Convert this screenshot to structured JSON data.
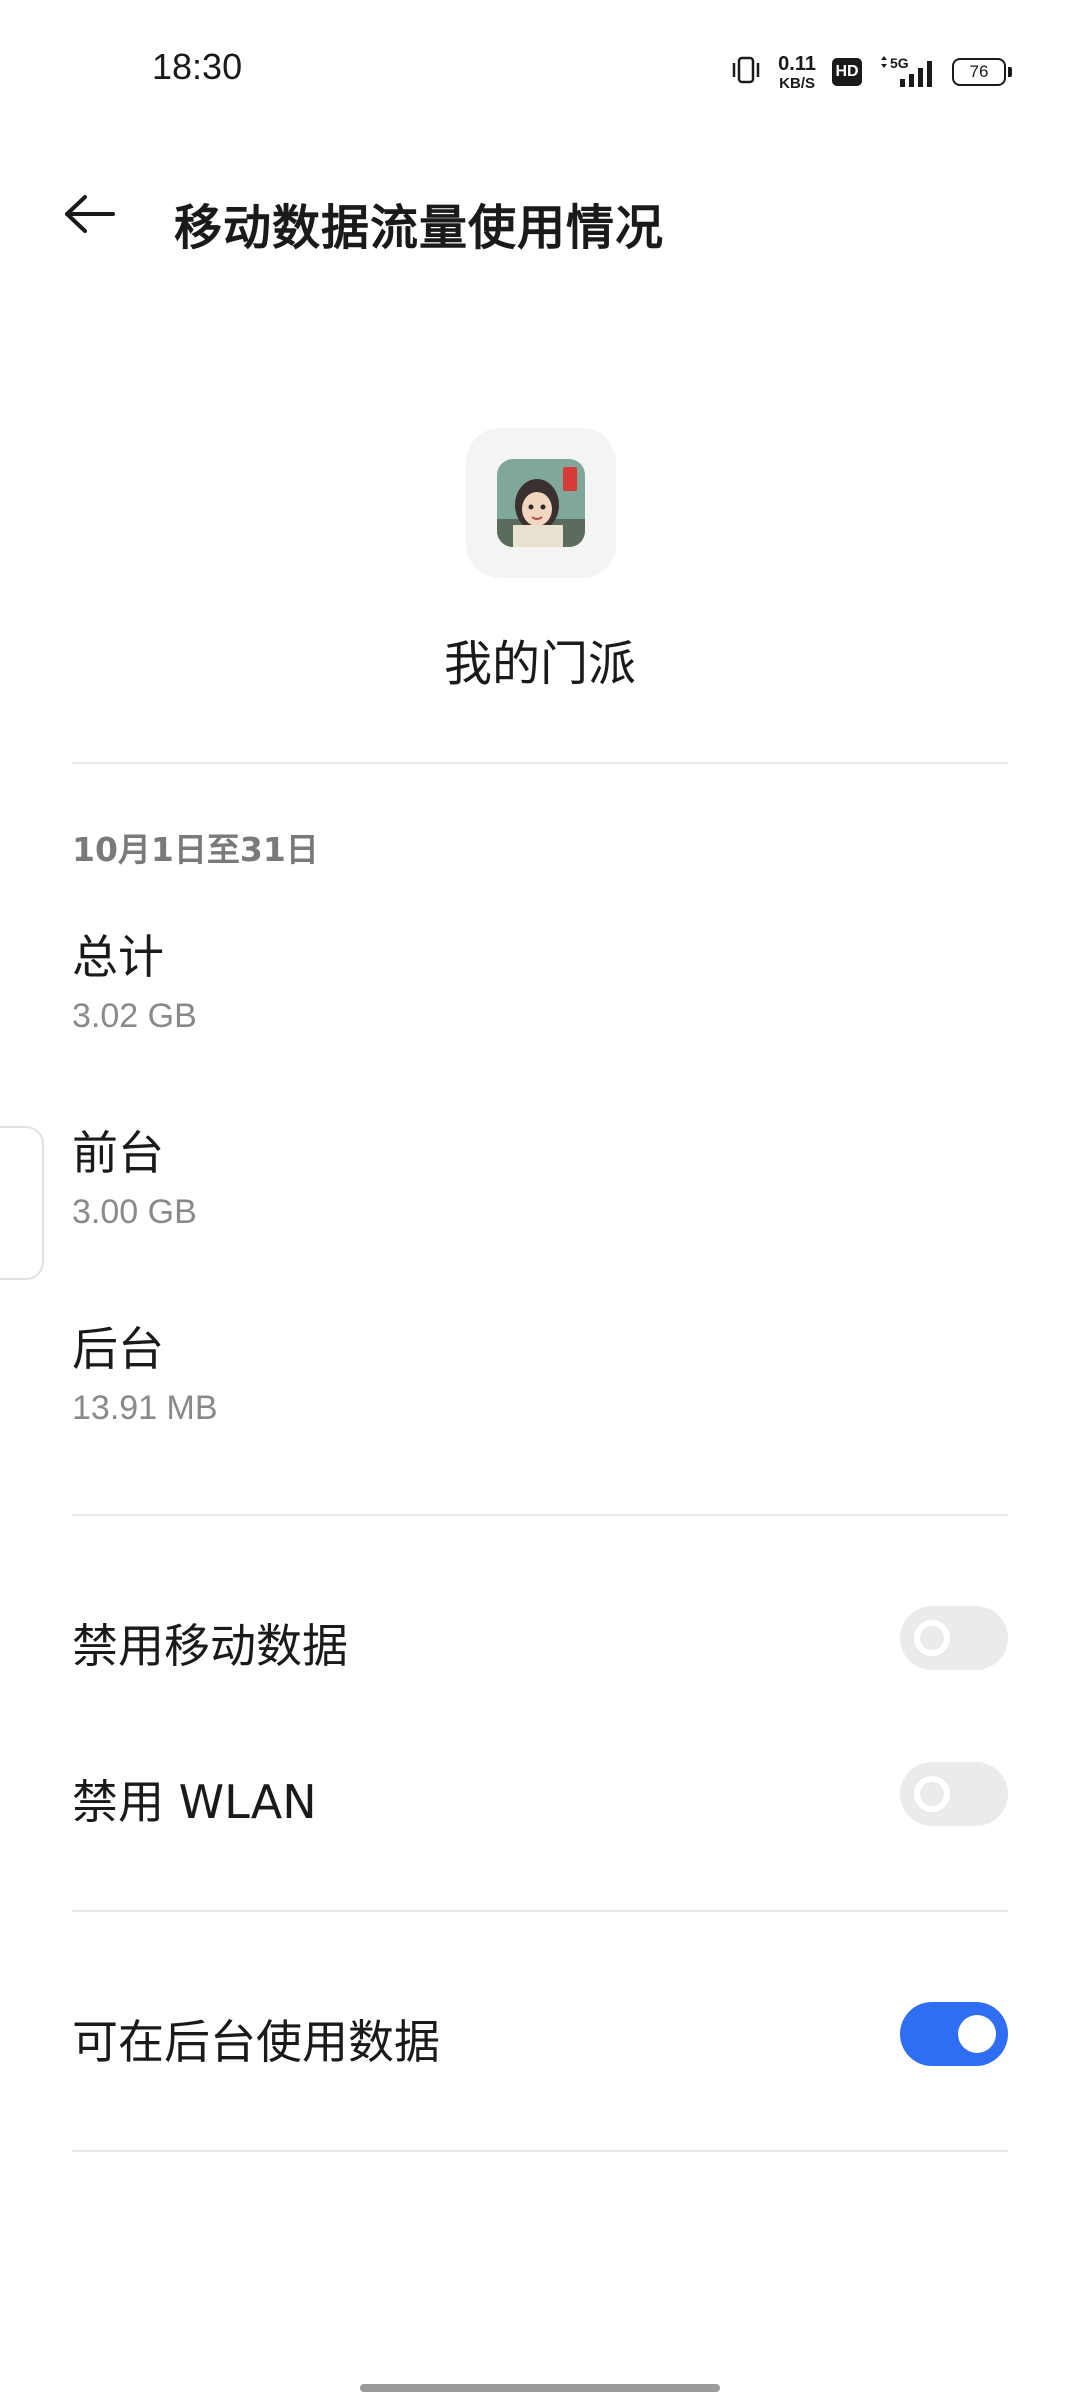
{
  "status_bar": {
    "time": "18:30",
    "net_speed_value": "0.11",
    "net_speed_unit": "KB/S",
    "hd_label": "HD",
    "network_type": "5G",
    "battery_level": "76",
    "icons": [
      "vibrate-icon",
      "hd-icon",
      "signal-5g-icon",
      "battery-icon"
    ]
  },
  "header": {
    "title": "移动数据流量使用情况",
    "back_icon": "arrow-left-icon"
  },
  "app": {
    "name": "我的门派",
    "icon": "app-icon"
  },
  "usage": {
    "period": "10月1日至31日",
    "total": {
      "label": "总计",
      "value": "3.02 GB"
    },
    "foreground": {
      "label": "前台",
      "value": "3.00 GB"
    },
    "background": {
      "label": "后台",
      "value": "13.91 MB"
    }
  },
  "settings": {
    "disable_mobile_data": {
      "label": "禁用移动数据",
      "enabled": false
    },
    "disable_wlan": {
      "label": "禁用 WLAN",
      "enabled": false
    },
    "allow_background_data": {
      "label": "可在后台使用数据",
      "enabled": true
    }
  },
  "colors": {
    "accent": "#2f6ef2",
    "toggle_off": "#ebebeb",
    "secondary_text": "#8a8a8a",
    "divider": "#e8e8e8"
  }
}
